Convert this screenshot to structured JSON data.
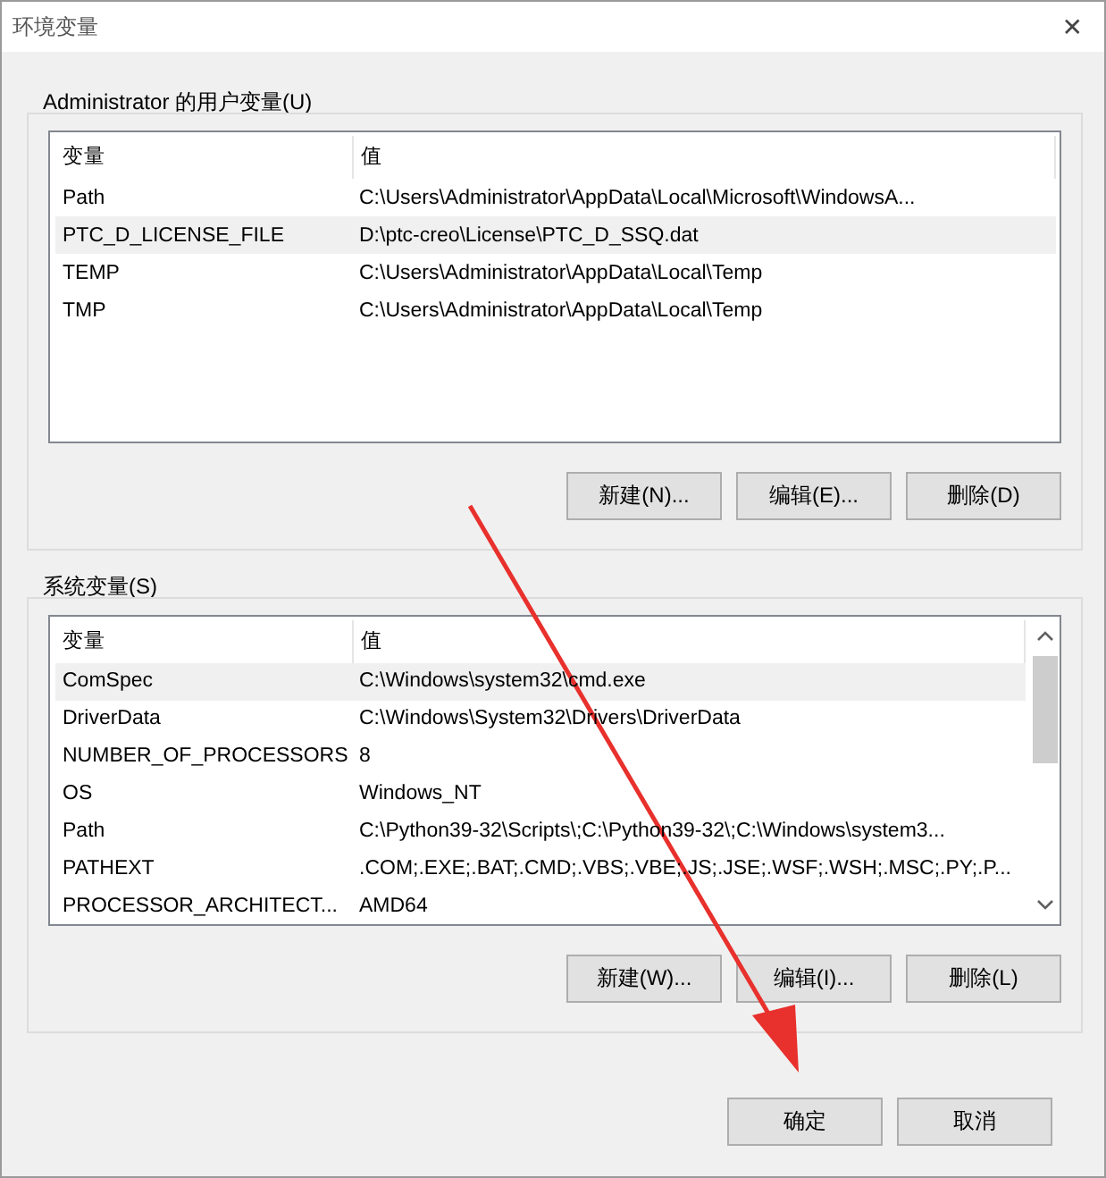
{
  "window": {
    "title": "环境变量",
    "close": "✕"
  },
  "user_variables": {
    "title": "Administrator 的用户变量(U)",
    "columns": [
      "变量",
      "值"
    ],
    "rows": [
      {
        "name": "Path",
        "value": "C:\\Users\\Administrator\\AppData\\Local\\Microsoft\\WindowsA...",
        "selected": false
      },
      {
        "name": "PTC_D_LICENSE_FILE",
        "value": "D:\\ptc-creo\\License\\PTC_D_SSQ.dat",
        "selected": true
      },
      {
        "name": "TEMP",
        "value": "C:\\Users\\Administrator\\AppData\\Local\\Temp",
        "selected": false
      },
      {
        "name": "TMP",
        "value": "C:\\Users\\Administrator\\AppData\\Local\\Temp",
        "selected": false
      }
    ],
    "buttons": [
      "新建(N)...",
      "编辑(E)...",
      "删除(D)"
    ]
  },
  "system_variables": {
    "title": "系统变量(S)",
    "columns": [
      "变量",
      "值"
    ],
    "rows": [
      {
        "name": "ComSpec",
        "value": "C:\\Windows\\system32\\cmd.exe",
        "selected": true
      },
      {
        "name": "DriverData",
        "value": "C:\\Windows\\System32\\Drivers\\DriverData",
        "selected": false
      },
      {
        "name": "NUMBER_OF_PROCESSORS",
        "value": "8",
        "selected": false
      },
      {
        "name": "OS",
        "value": "Windows_NT",
        "selected": false
      },
      {
        "name": "Path",
        "value": "C:\\Python39-32\\Scripts\\;C:\\Python39-32\\;C:\\Windows\\system3...",
        "selected": false
      },
      {
        "name": "PATHEXT",
        "value": ".COM;.EXE;.BAT;.CMD;.VBS;.VBE;.JS;.JSE;.WSF;.WSH;.MSC;.PY;.P...",
        "selected": false
      },
      {
        "name": "PROCESSOR_ARCHITECT...",
        "value": "AMD64",
        "selected": false
      }
    ],
    "buttons": [
      "新建(W)...",
      "编辑(I)...",
      "删除(L)"
    ]
  },
  "footer_buttons": [
    "确定",
    "取消"
  ]
}
